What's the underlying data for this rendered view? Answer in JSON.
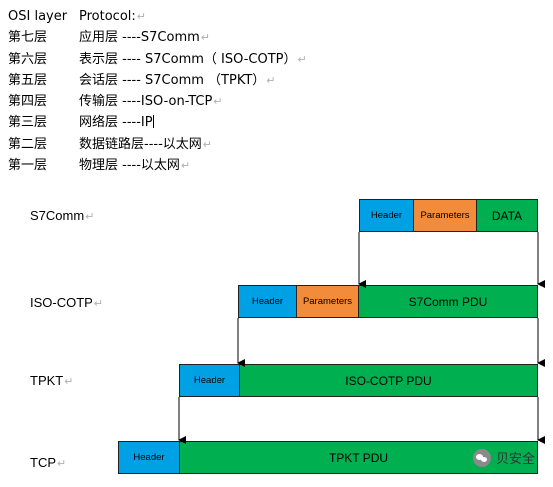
{
  "osi": {
    "header": {
      "layer": "OSI layer",
      "protocol": "Protocol:"
    },
    "rows": [
      {
        "layer": "第七层",
        "protocol": "应用层 ----S7Comm"
      },
      {
        "layer": "第六层",
        "protocol": "表示层 ---- S7Comm（ ISO-COTP）"
      },
      {
        "layer": "第五层",
        "protocol": "会话层 ---- S7Comm  （TPKT）"
      },
      {
        "layer": "第四层",
        "protocol": "传输层 ----ISO-on-TCP"
      },
      {
        "layer": "第三层",
        "protocol": "网络层 ----IP"
      },
      {
        "layer": "第二层",
        "protocol": "数据链路层----以太网"
      },
      {
        "layer": "第一层",
        "protocol": "物理层 ----以太网"
      }
    ]
  },
  "diagram": {
    "rows": [
      {
        "label": "S7Comm",
        "cells": [
          "Header",
          "Parameters",
          "DATA"
        ]
      },
      {
        "label": "ISO-COTP",
        "cells": [
          "Header",
          "Parameters",
          "S7Comm PDU"
        ]
      },
      {
        "label": "TPKT",
        "cells": [
          "Header",
          "ISO-COTP PDU"
        ]
      },
      {
        "label": "TCP",
        "cells": [
          "Header",
          "TPKT PDU"
        ]
      }
    ]
  },
  "paragraph_mark": "↵",
  "watermark": {
    "text": "贝安全",
    "icon": "wechat-icon"
  }
}
